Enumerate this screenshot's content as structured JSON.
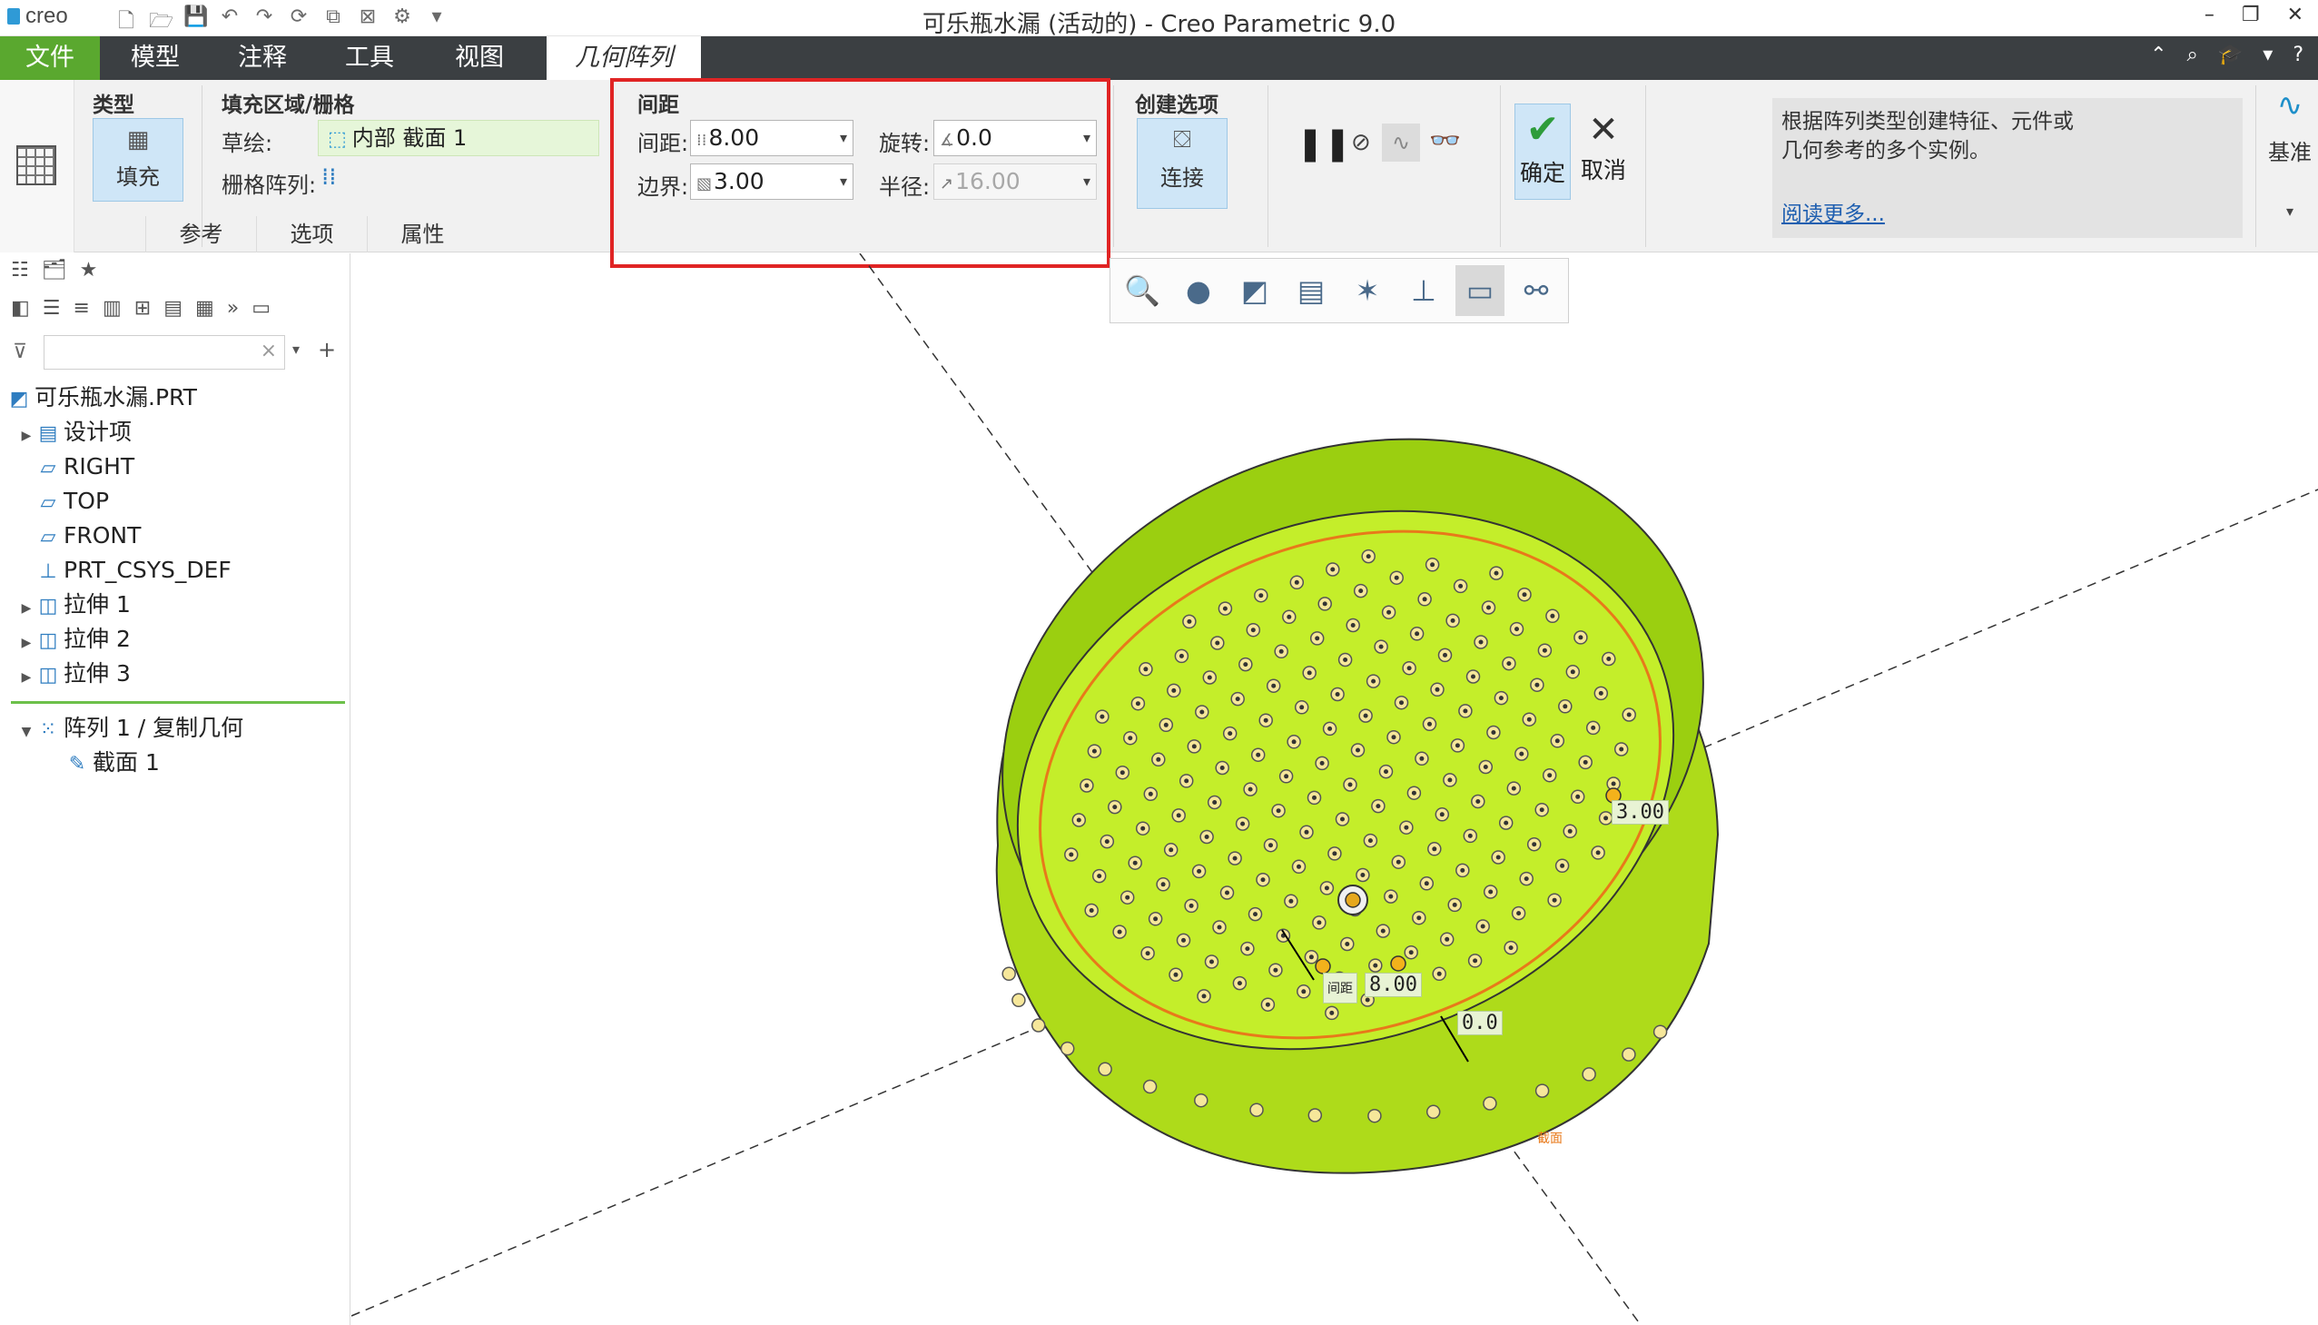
{
  "app": {
    "logo": "creo",
    "window_title": "可乐瓶水漏 (活动的) - Creo Parametric 9.0"
  },
  "menu": {
    "tabs": [
      "文件",
      "模型",
      "注释",
      "工具",
      "视图",
      "几何阵列"
    ],
    "active_tab": "几何阵列"
  },
  "ribbon": {
    "type_group": {
      "title": "类型",
      "fill_label": "填充"
    },
    "fill_group": {
      "title": "填充区域/栅格",
      "sketch_label": "草绘:",
      "sketch_value": "内部 截面 1",
      "grid_label": "栅格阵列:"
    },
    "spacing_group": {
      "title": "间距",
      "spacing_label": "间距:",
      "spacing_value": "8.00",
      "border_label": "边界:",
      "border_value": "3.00",
      "rotation_label": "旋转:",
      "rotation_value": "0.0",
      "radius_label": "半径:",
      "radius_value": "16.00"
    },
    "create_group": {
      "title": "创建选项",
      "connect_label": "连接"
    },
    "ok_label": "确定",
    "cancel_label": "取消",
    "help": {
      "line1": "根据阵列类型创建特征、元件或",
      "line2": "几何参考的多个实例。",
      "link": "阅读更多..."
    },
    "basis_label": "基准",
    "subtabs": [
      "参考",
      "选项",
      "属性"
    ]
  },
  "tree": {
    "root": "可乐瓶水漏.PRT",
    "items": [
      {
        "label": "设计项",
        "icon": "design-items-icon",
        "expandable": true
      },
      {
        "label": "RIGHT",
        "icon": "datum-plane-icon",
        "expandable": false
      },
      {
        "label": "TOP",
        "icon": "datum-plane-icon",
        "expandable": false
      },
      {
        "label": "FRONT",
        "icon": "datum-plane-icon",
        "expandable": false
      },
      {
        "label": "PRT_CSYS_DEF",
        "icon": "csys-icon",
        "expandable": false
      },
      {
        "label": "拉伸 1",
        "icon": "extrude-icon",
        "expandable": true
      },
      {
        "label": "拉伸 2",
        "icon": "extrude-icon",
        "expandable": true
      },
      {
        "label": "拉伸 3",
        "icon": "extrude-icon",
        "expandable": true
      }
    ],
    "pattern_node": "阵列 1 / 复制几何",
    "section_node": "截面 1"
  },
  "viewport": {
    "dim_border": "3.00",
    "dim_spacing_label": "间距",
    "dim_spacing": "8.00",
    "dim_rotation": "0.0",
    "section_tag": "截面",
    "model_color": "#b5e61d",
    "hole_color": "#e6a81e"
  }
}
